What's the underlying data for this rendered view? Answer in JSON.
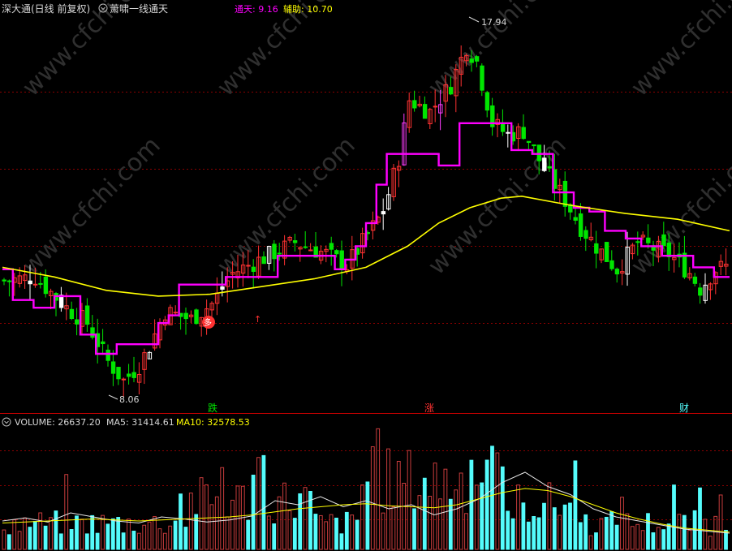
{
  "main_panel": {
    "ticker": "深大通(日线 前复权)",
    "indicator_name": "萧啸一线通天",
    "line1_label": "通天: 9.16",
    "line2_label": "辅助: 10.70",
    "high_label": "17.94",
    "low_label": "8.06",
    "markers": [
      "跌",
      "涨",
      "财",
      "多"
    ]
  },
  "volume_panel": {
    "vol_label": "VOLUME: 26637.20",
    "ma5_label": "MA5: 31414.61",
    "ma10_label": "MA10: 32578.53"
  },
  "watermark": "www.cfchi.com",
  "colors": {
    "up": "#ff3232",
    "down": "#00e600",
    "tongtian": "#ff00ff",
    "fuzhu": "#ffff00",
    "vol_up": "#c83c3c",
    "vol_down": "#54fcfc",
    "grid": "#8b0000",
    "label_white": "#d8d8d8"
  },
  "chart_data": {
    "type": "candlestick",
    "price_range": [
      8.06,
      17.94
    ],
    "tongtian_steps": [
      [
        0,
        11.4
      ],
      [
        2,
        10.6
      ],
      [
        5,
        10.6
      ],
      [
        6,
        10.4
      ],
      [
        10,
        10.7
      ],
      [
        14,
        10.7
      ],
      [
        15,
        9.7
      ],
      [
        18,
        9.2
      ],
      [
        22,
        9.45
      ],
      [
        28,
        9.45
      ],
      [
        30,
        10.0
      ],
      [
        32,
        10.2
      ],
      [
        34,
        11.0
      ],
      [
        42,
        11.0
      ],
      [
        43,
        11.2
      ],
      [
        52,
        11.2
      ],
      [
        53,
        11.75
      ],
      [
        62,
        11.75
      ],
      [
        64,
        11.4
      ],
      [
        66,
        11.65
      ],
      [
        68,
        12.0
      ],
      [
        70,
        12.6
      ],
      [
        72,
        13.6
      ],
      [
        74,
        14.4
      ],
      [
        82,
        14.4
      ],
      [
        84,
        14.1
      ],
      [
        88,
        15.2
      ],
      [
        95,
        15.2
      ],
      [
        98,
        14.5
      ],
      [
        102,
        14.4
      ],
      [
        106,
        13.4
      ],
      [
        110,
        13.0
      ],
      [
        113,
        12.9
      ],
      [
        116,
        12.4
      ],
      [
        120,
        12.2
      ],
      [
        123,
        12.0
      ],
      [
        127,
        11.75
      ],
      [
        131,
        11.75
      ],
      [
        133,
        11.45
      ],
      [
        135,
        11.45
      ],
      [
        137,
        11.2
      ],
      [
        140,
        11.2
      ]
    ],
    "fuzhu_curve": [
      [
        0,
        11.45
      ],
      [
        10,
        11.2
      ],
      [
        20,
        10.85
      ],
      [
        30,
        10.7
      ],
      [
        40,
        10.75
      ],
      [
        50,
        10.95
      ],
      [
        60,
        11.15
      ],
      [
        70,
        11.45
      ],
      [
        78,
        12.0
      ],
      [
        84,
        12.6
      ],
      [
        90,
        13.0
      ],
      [
        96,
        13.25
      ],
      [
        100,
        13.3
      ],
      [
        110,
        13.05
      ],
      [
        120,
        12.85
      ],
      [
        130,
        12.7
      ],
      [
        140,
        12.4
      ]
    ],
    "volume_ma5": [
      14000,
      15500,
      13500,
      18000,
      16000,
      14000,
      13000,
      16000,
      15000,
      13500,
      14500,
      16500,
      24000,
      22000,
      26000,
      21000,
      24000,
      20000,
      22000,
      17000,
      20000,
      25000,
      33000,
      38000,
      31000,
      27000,
      20000,
      16000,
      14000,
      12000,
      10000,
      9000,
      8000
    ],
    "volume_ma10": [
      13000,
      13500,
      14000,
      14500,
      15000,
      14500,
      14000,
      14500,
      15000,
      15500,
      16000,
      17000,
      18500,
      20000,
      21000,
      22000,
      22500,
      21500,
      21000,
      20500,
      22000,
      25000,
      28000,
      30000,
      29000,
      26000,
      22000,
      18000,
      15000,
      12500,
      10500,
      9500,
      8500
    ]
  }
}
